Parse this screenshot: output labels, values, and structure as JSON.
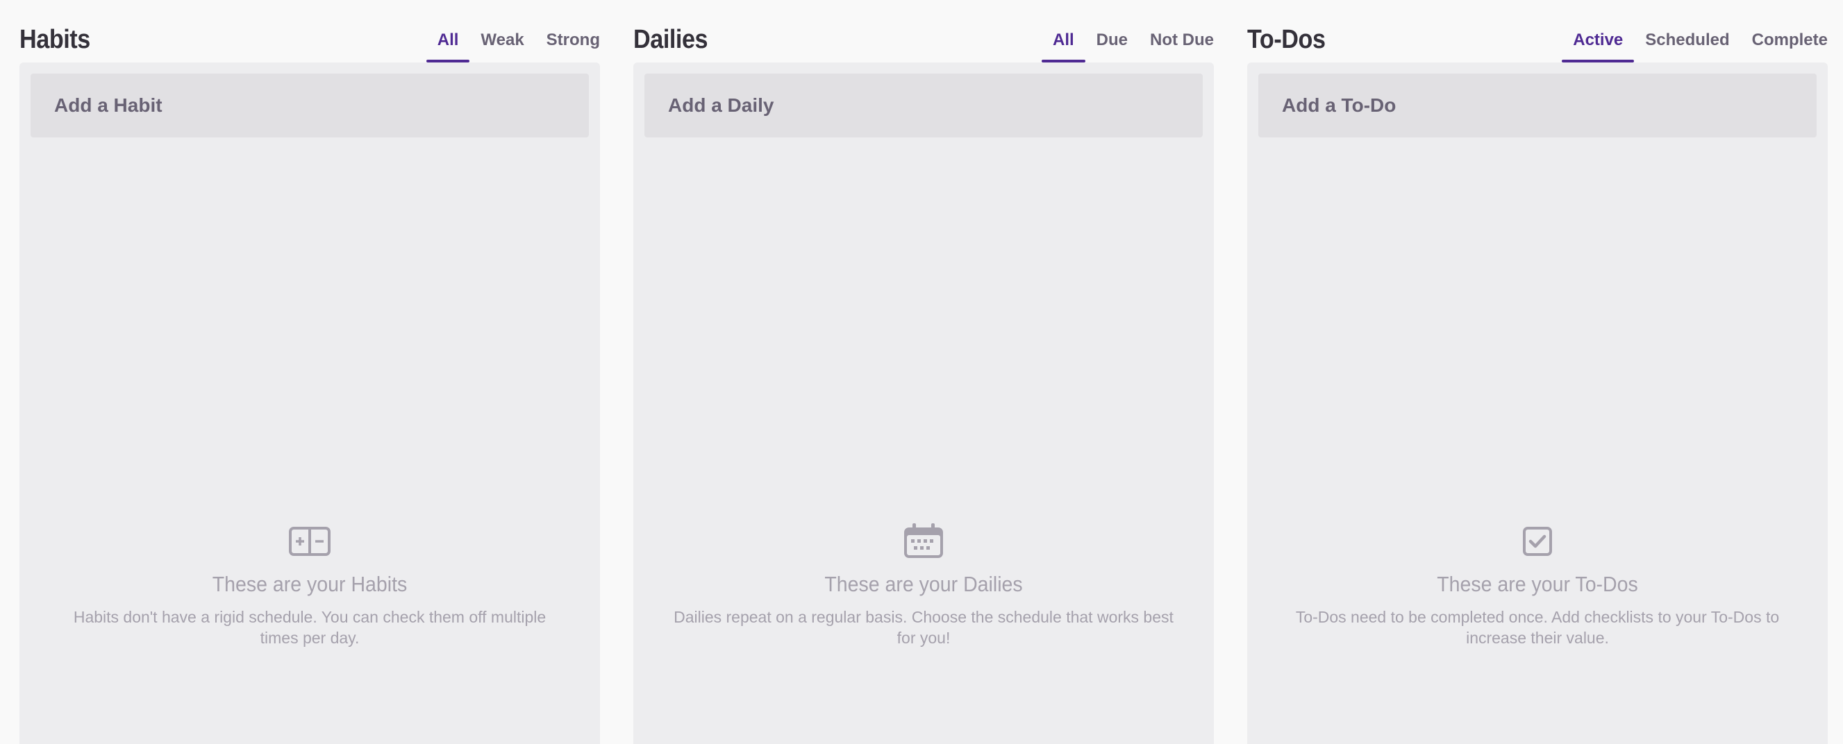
{
  "colors": {
    "accent": "#4f2a93",
    "panel": "#ededef",
    "add_bar": "#e1e0e3",
    "title": "#34313a",
    "muted": "#a5a1ac"
  },
  "habits": {
    "title": "Habits",
    "tabs": [
      {
        "label": "All",
        "active": true
      },
      {
        "label": "Weak",
        "active": false
      },
      {
        "label": "Strong",
        "active": false
      }
    ],
    "add_label": "Add a Habit",
    "empty_icon": "habit-plus-minus-icon",
    "empty_title": "These are your Habits",
    "empty_desc": "Habits don't have a rigid schedule. You can check them off multiple times per day."
  },
  "dailies": {
    "title": "Dailies",
    "tabs": [
      {
        "label": "All",
        "active": true
      },
      {
        "label": "Due",
        "active": false
      },
      {
        "label": "Not Due",
        "active": false
      }
    ],
    "add_label": "Add a Daily",
    "empty_icon": "calendar-icon",
    "empty_title": "These are your Dailies",
    "empty_desc": "Dailies repeat on a regular basis. Choose the schedule that works best for you!"
  },
  "todos": {
    "title": "To-Dos",
    "tabs": [
      {
        "label": "Active",
        "active": true
      },
      {
        "label": "Scheduled",
        "active": false
      },
      {
        "label": "Complete",
        "active": false
      }
    ],
    "add_label": "Add a To-Do",
    "empty_icon": "checkbox-icon",
    "empty_title": "These are your To-Dos",
    "empty_desc": "To-Dos need to be completed once. Add checklists to your To-Dos to increase their value."
  }
}
